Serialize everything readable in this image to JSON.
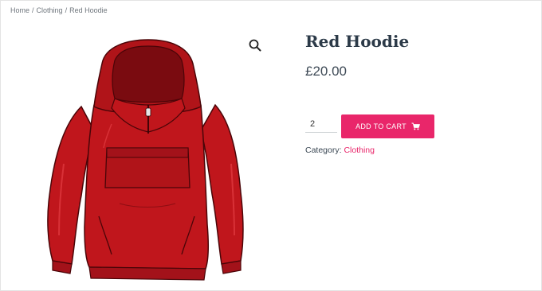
{
  "breadcrumb": {
    "items": [
      "Home",
      "Clothing",
      "Red Hoodie"
    ],
    "separator": "/"
  },
  "product": {
    "title": "Red Hoodie",
    "price": "£20.00",
    "quantity": "2",
    "add_to_cart_label": "ADD TO CART",
    "category_label": "Category:",
    "category_value": "Clothing",
    "image_alt": "red-hoodie-illustration"
  },
  "icons": {
    "zoom": "magnifier-icon",
    "cart": "cart-icon"
  },
  "colors": {
    "accent": "#e9266a",
    "hoodie": "#c0161c",
    "hoodie_dark": "#8e0e13",
    "title": "#2c3a48",
    "text": "#3a4753",
    "muted": "#6f767d"
  }
}
